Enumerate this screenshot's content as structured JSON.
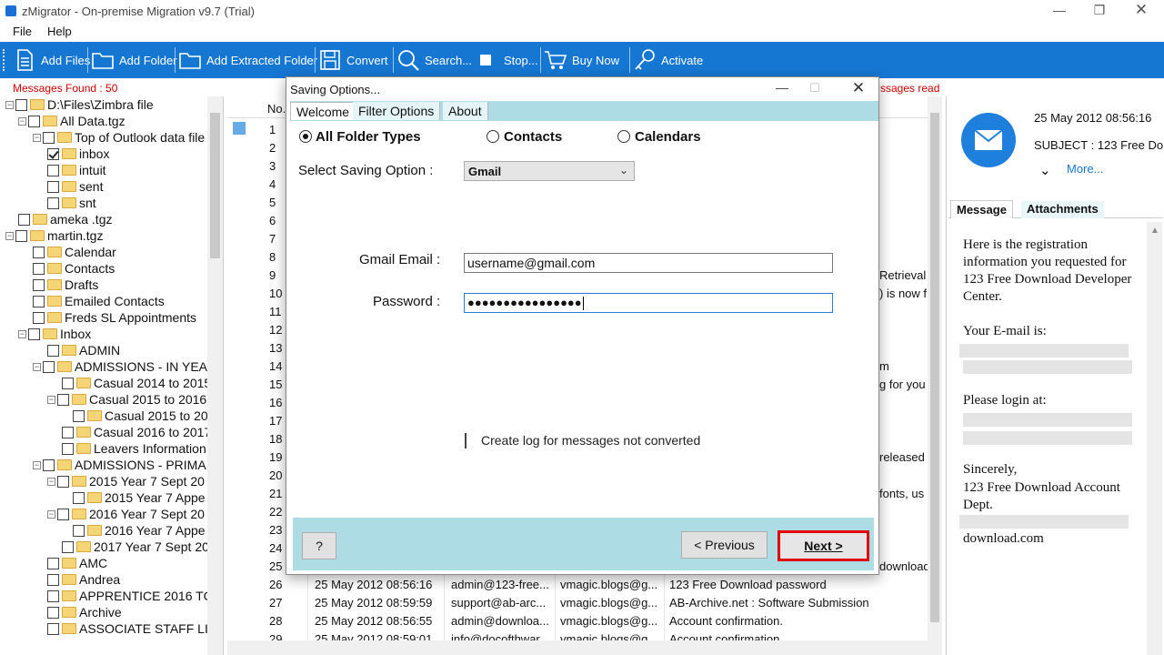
{
  "window": {
    "title": "zMigrator - On-premise Migration v9.7 (Trial)"
  },
  "menu": [
    "File",
    "Help"
  ],
  "toolbar": {
    "add_files": "Add Files",
    "add_folder": "Add Folder",
    "add_extracted_folder": "Add Extracted Folder",
    "convert": "Convert",
    "search": "Search...",
    "stop": "Stop...",
    "buy_now": "Buy Now",
    "activate": "Activate"
  },
  "status": {
    "messages_found": "Messages Found : 50",
    "messages_read": "ssages read"
  },
  "tree": [
    {
      "label": "D:\\Files\\Zimbra file",
      "checked": false
    },
    {
      "label": "All Data.tgz",
      "checked": false
    },
    {
      "label": "Top of Outlook data file",
      "checked": false
    },
    {
      "label": "inbox",
      "checked": true
    },
    {
      "label": "intuit",
      "checked": false
    },
    {
      "label": "sent",
      "checked": false
    },
    {
      "label": "snt",
      "checked": false
    },
    {
      "label": "ameka .tgz",
      "checked": false
    },
    {
      "label": "martin.tgz",
      "checked": false
    },
    {
      "label": "Calendar",
      "checked": false
    },
    {
      "label": "Contacts",
      "checked": false
    },
    {
      "label": "Drafts",
      "checked": false
    },
    {
      "label": "Emailed Contacts",
      "checked": false
    },
    {
      "label": "Freds  SL Appointments",
      "checked": false
    },
    {
      "label": "Inbox",
      "checked": false
    },
    {
      "label": "ADMIN",
      "checked": false
    },
    {
      "label": "ADMISSIONS - IN YEA",
      "checked": false
    },
    {
      "label": "Casual 2014 to 2015",
      "checked": false
    },
    {
      "label": "Casual 2015 to 2016",
      "checked": false
    },
    {
      "label": "Casual 2015 to 20",
      "checked": false
    },
    {
      "label": "Casual 2016 to 2017",
      "checked": false
    },
    {
      "label": "Leavers Information",
      "checked": false
    },
    {
      "label": "ADMISSIONS - PRIMA",
      "checked": false
    },
    {
      "label": "2015 Year 7 Sept 20",
      "checked": false
    },
    {
      "label": "2015 Year 7 Appe",
      "checked": false
    },
    {
      "label": "2016 Year 7 Sept 20",
      "checked": false
    },
    {
      "label": "2016 Year 7 Appe",
      "checked": false
    },
    {
      "label": "2017 Year 7 Sept 20",
      "checked": false
    },
    {
      "label": "AMC",
      "checked": false
    },
    {
      "label": "Andrea",
      "checked": false
    },
    {
      "label": "APPRENTICE 2016 TC",
      "checked": false
    },
    {
      "label": "Archive",
      "checked": false
    },
    {
      "label": "ASSOCIATE STAFF LI",
      "checked": false
    }
  ],
  "grid": {
    "header_no": "No.",
    "row_numbers": [
      "1",
      "2",
      "3",
      "4",
      "5",
      "6",
      "7",
      "8",
      "9",
      "10",
      "11",
      "12",
      "13",
      "14",
      "15",
      "16",
      "17",
      "18",
      "19",
      "20",
      "21",
      "22",
      "23",
      "24",
      "25"
    ],
    "side_snippets": [
      {
        "row": 9,
        "text": "Retrieval"
      },
      {
        "row": 10,
        "text": ") is now f"
      },
      {
        "row": 14,
        "text": "m"
      },
      {
        "row": 15,
        "text": "g for you"
      },
      {
        "row": 19,
        "text": "released"
      },
      {
        "row": 21,
        "text": "fonts, us"
      },
      {
        "row": 25,
        "text": "download"
      }
    ],
    "rows": [
      {
        "no": "26",
        "date": "25 May 2012 08:56:16",
        "from": "admin@123-free...",
        "to": "vmagic.blogs@g...",
        "subject": "123 Free Download password"
      },
      {
        "no": "27",
        "date": "25 May 2012 08:59:59",
        "from": "support@ab-arc...",
        "to": "vmagic.blogs@g...",
        "subject": "AB-Archive.net : Software Submission"
      },
      {
        "no": "28",
        "date": "25 May 2012 08:56:55",
        "from": "admin@downloa...",
        "to": "vmagic.blogs@g...",
        "subject": "Account confirmation."
      },
      {
        "no": "29",
        "date": "25 May 2012 08:59:01",
        "from": "info@docofthwar...",
        "to": "vmagic.blogs@g...",
        "subject": "Account confirmation"
      }
    ]
  },
  "preview": {
    "date": "25 May 2012 08:56:16",
    "subject": "SUBJECT : 123 Free Do",
    "more": "More...",
    "tabs": [
      "Message",
      "Attachments"
    ],
    "body": {
      "p1": "Here is the registration information you requested for 123 Free Download Developer Center.",
      "p2": "Your E-mail is:",
      "p3": "Please login at:",
      "p4": "Sincerely,",
      "p5": "123 Free Download Account Dept.",
      "p6": "download.com"
    }
  },
  "dialog": {
    "title": "Saving Options...",
    "tabs": [
      "Welcome",
      "Filter Options",
      "About"
    ],
    "radios": [
      {
        "label": "All Folder Types",
        "selected": true
      },
      {
        "label": "Contacts",
        "selected": false
      },
      {
        "label": "Calendars",
        "selected": false
      }
    ],
    "saving_option_label": "Select Saving Option :",
    "saving_option_value": "Gmail",
    "email_label": "Gmail Email :",
    "email_value": "username@gmail.com",
    "password_label": "Password :",
    "password_value": "●●●●●●●●●●●●●●●●",
    "log_checkbox": "Create log for messages not converted",
    "help_button": "?",
    "previous_button": "< Previous",
    "next_button": "Next >"
  },
  "colors": {
    "toolbar": "#1677d3",
    "dialog_panel": "#aedce4",
    "accent_red": "#e00000"
  }
}
